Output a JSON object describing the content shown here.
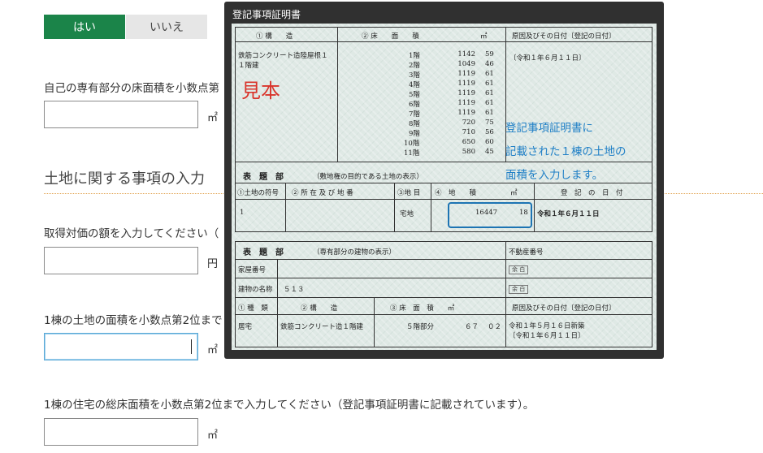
{
  "form": {
    "yes_label": "はい",
    "no_label": "いいえ",
    "q_own_area": "自己の専有部分の床面積を小数点第",
    "unit_sqm": "㎡",
    "section_land": "土地に関する事項の入力",
    "q_price": "取得対価の額を入力してください（",
    "unit_yen": "円",
    "q_land_area": "1棟の土地の面積を小数点第2位まで",
    "q_total_floor": "1棟の住宅の総床面積を小数点第2位まで入力してください（登記事項証明書に記載されています）。"
  },
  "modal": {
    "title": "登記事項証明書",
    "sample_label": "見本",
    "annotation": [
      "登記事項証明書に",
      "記載された１棟の土地の",
      "面積を入力します。"
    ],
    "header_struct": "① 構　　造",
    "header_area": "② 床　　面　　積",
    "header_unit": "㎡",
    "header_cause": "原因及びその日付〔登記の日付〕",
    "struct_text_1": "鉄筋コンクリート造陸屋根１",
    "struct_text_2": "１階建",
    "floors": [
      {
        "floor": "1階",
        "area": "1142",
        "dec": "59"
      },
      {
        "floor": "2階",
        "area": "1049",
        "dec": "46"
      },
      {
        "floor": "3階",
        "area": "1119",
        "dec": "61"
      },
      {
        "floor": "4階",
        "area": "1119",
        "dec": "61"
      },
      {
        "floor": "5階",
        "area": "1119",
        "dec": "61"
      },
      {
        "floor": "6階",
        "area": "1119",
        "dec": "61"
      },
      {
        "floor": "7階",
        "area": "1119",
        "dec": "61"
      },
      {
        "floor": "8階",
        "area": "720",
        "dec": "75"
      },
      {
        "floor": "9階",
        "area": "710",
        "dec": "56"
      },
      {
        "floor": "10階",
        "area": "650",
        "dec": "60"
      },
      {
        "floor": "11階",
        "area": "580",
        "dec": "45"
      }
    ],
    "date_1": "〔令和１年６月１１日〕",
    "land_header": "表　題　部",
    "land_header_note": "（敷地権の目的である土地の表示）",
    "land_cols": {
      "c1": "①土地の符号",
      "c2": "② 所 在 及 び 地 番",
      "c3": "③地 目",
      "c4": "④　地　　積",
      "c5": "㎡",
      "c6": "登　記　の　日　付"
    },
    "land_row": {
      "code": "1",
      "category": "宅地",
      "area": "16447",
      "dec": "18",
      "date": "令和１年６月１１日"
    },
    "unit_header": "表　題　部",
    "unit_header_note": "（専有部分の建物の表示）",
    "real_estate_no": "不動産番号",
    "house_no": "家屋番号",
    "building_name_label": "建物の名称",
    "building_name": "５１３",
    "blank": "余 白",
    "unit_cols": {
      "c1": "① 種　類",
      "c2": "② 構　　造",
      "c3": "③ 床　面　積　　㎡",
      "c4": "原因及びその日付〔登記の日付〕"
    },
    "unit_row": {
      "kind": "居宅",
      "struct": "鉄筋コンクリート造１階建",
      "floor": "５階部分",
      "area": "６７",
      "dec": "０２",
      "date1": "令和１年５月１６日新築",
      "date2": "〔令和１年６月１１日〕"
    }
  }
}
